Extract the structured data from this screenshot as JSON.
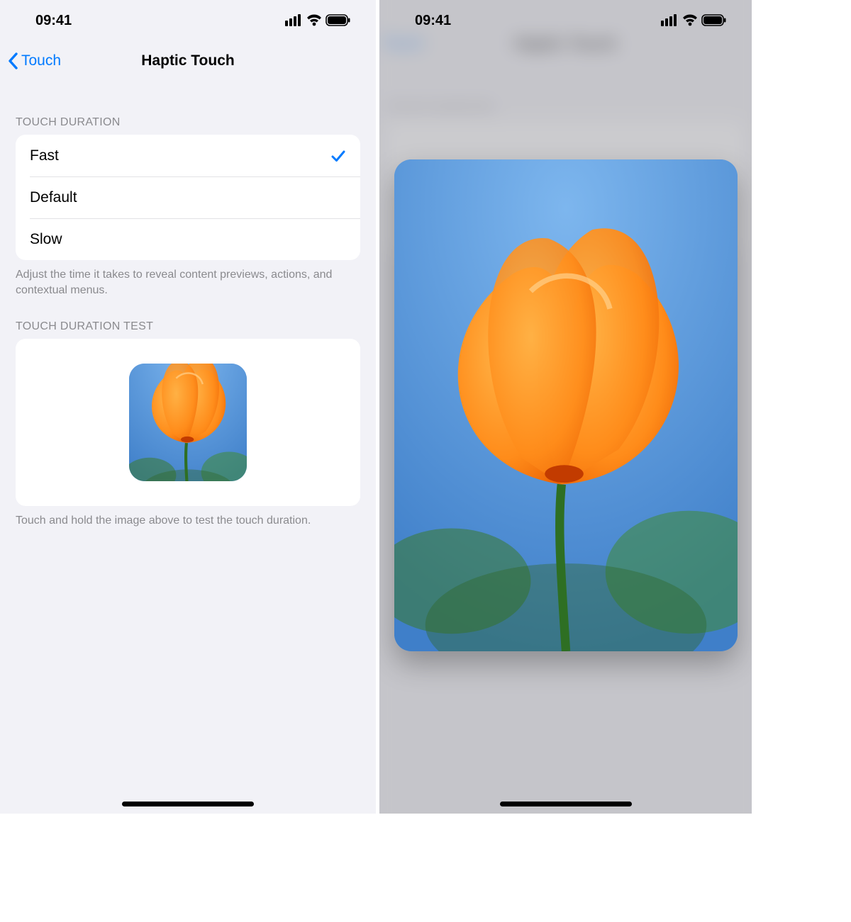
{
  "status": {
    "time": "09:41"
  },
  "nav": {
    "back_label": "Touch",
    "title": "Haptic Touch"
  },
  "duration": {
    "header": "TOUCH DURATION",
    "options": [
      {
        "label": "Fast",
        "selected": true
      },
      {
        "label": "Default",
        "selected": false
      },
      {
        "label": "Slow",
        "selected": false
      }
    ],
    "footer": "Adjust the time it takes to reveal content previews, actions, and contextual menus."
  },
  "test": {
    "header": "TOUCH DURATION TEST",
    "footer": "Touch and hold the image above to test the touch duration."
  },
  "icons": {
    "back": "chevron-left-icon",
    "check": "checkmark-icon",
    "signal": "cell-signal-icon",
    "wifi": "wifi-icon",
    "battery": "battery-icon",
    "image": "poppy-flower-image"
  }
}
